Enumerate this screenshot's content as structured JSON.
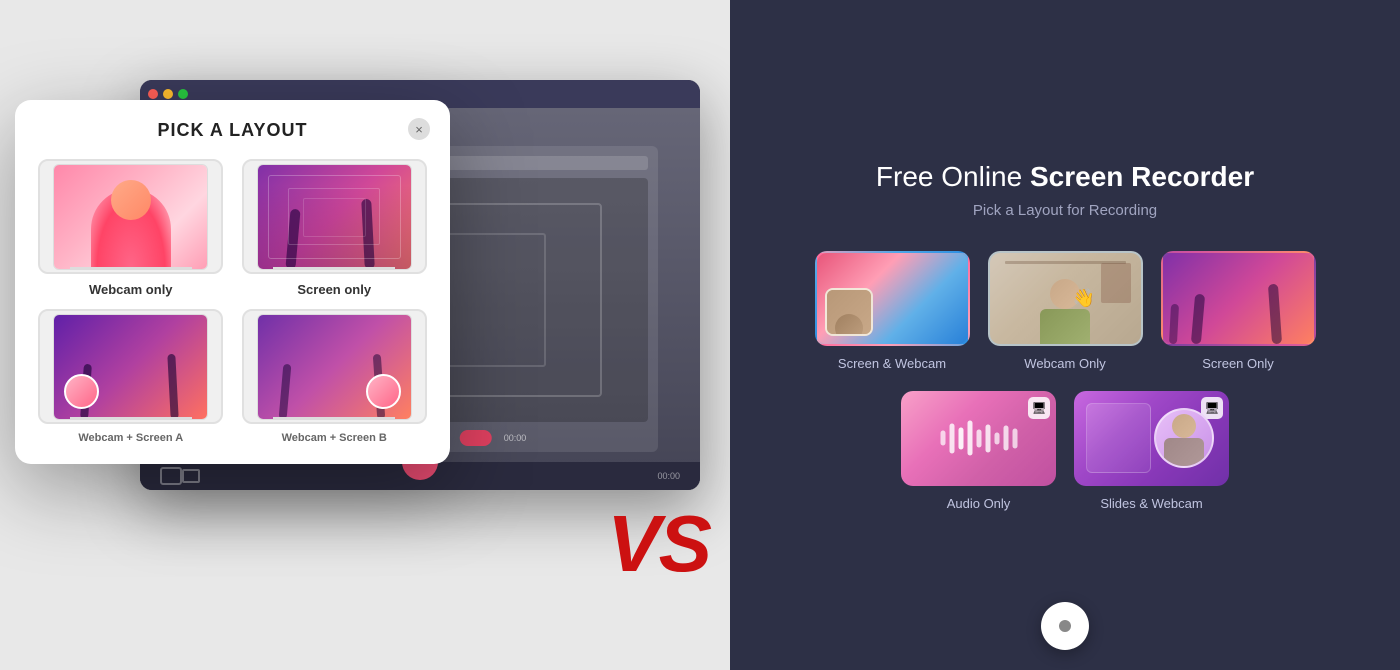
{
  "left": {
    "modal": {
      "title": "PICK A LAYOUT",
      "close_label": "×",
      "layouts": [
        {
          "id": "webcam-only",
          "label": "Webcam only",
          "type": "webcam"
        },
        {
          "id": "screen-only",
          "label": "Screen only",
          "type": "screen"
        },
        {
          "id": "screen-webcam-1",
          "label": "Webcam + Screen A",
          "type": "combined"
        },
        {
          "id": "screen-webcam-2",
          "label": "Webcam + Screen B",
          "type": "combined2"
        }
      ]
    },
    "vs_label": "VS"
  },
  "right": {
    "title_prefix": "Free Online ",
    "title_bold": "Screen Recorder",
    "subtitle": "Pick a Layout for Recording",
    "options": [
      {
        "id": "screen-webcam",
        "label": "Screen & Webcam"
      },
      {
        "id": "webcam-only",
        "label": "Webcam Only"
      },
      {
        "id": "screen-only",
        "label": "Screen Only"
      },
      {
        "id": "audio-only",
        "label": "Audio Only"
      },
      {
        "id": "slides-webcam",
        "label": "Slides & Webcam"
      }
    ],
    "bottom_button_label": ""
  }
}
